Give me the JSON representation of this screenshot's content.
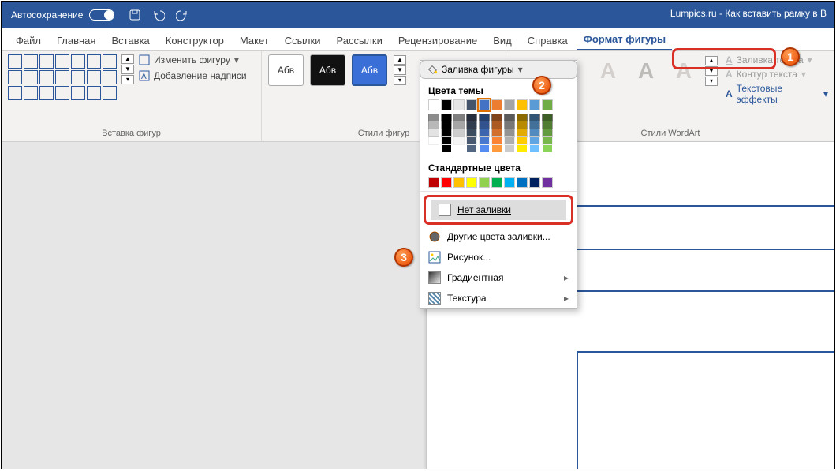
{
  "titlebar": {
    "autosave": "Автосохранение",
    "document_title": "Lumpics.ru - Как вставить рамку в В"
  },
  "tabs": {
    "file": "Файл",
    "home": "Главная",
    "insert": "Вставка",
    "design": "Конструктор",
    "layout": "Макет",
    "references": "Ссылки",
    "mailings": "Рассылки",
    "review": "Рецензирование",
    "view": "Вид",
    "help": "Справка",
    "shape_format": "Формат фигуры"
  },
  "ribbon": {
    "insert_shapes": {
      "label": "Вставка фигур",
      "edit_shape": "Изменить фигуру",
      "add_textbox": "Добавление надписи"
    },
    "shape_styles": {
      "label": "Стили фигур",
      "sample_text": "Абв",
      "shape_fill": "Заливка фигуры"
    },
    "wordart_styles": {
      "label": "Стили WordArt",
      "sample_text": "A",
      "text_fill": "Заливка текста",
      "text_outline": "Контур текста",
      "text_effects": "Текстовые эффекты"
    }
  },
  "dropdown": {
    "theme_colors": "Цвета темы",
    "standard_colors": "Стандартные цвета",
    "no_fill": "Нет заливки",
    "more_colors": "Другие цвета заливки...",
    "picture": "Рисунок...",
    "gradient": "Градиентная",
    "texture": "Текстура",
    "theme_color_values": [
      "#ffffff",
      "#000000",
      "#e7e6e6",
      "#44546a",
      "#4472c4",
      "#ed7d31",
      "#a5a5a5",
      "#ffc000",
      "#5b9bd5",
      "#70ad47"
    ],
    "standard_color_values": [
      "#c00000",
      "#ff0000",
      "#ffc000",
      "#ffff00",
      "#92d050",
      "#00b050",
      "#00b0f0",
      "#0070c0",
      "#002060",
      "#7030a0"
    ]
  },
  "callouts": {
    "one": "1",
    "two": "2",
    "three": "3"
  }
}
